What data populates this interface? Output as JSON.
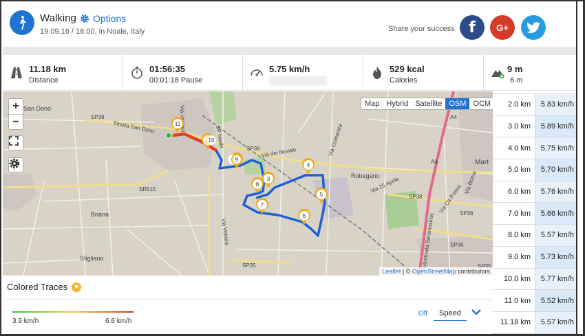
{
  "header": {
    "title": "Walking",
    "options_label": "Options",
    "subtitle": "19.09.16 / 16:00, in Noale, Italy",
    "share_text": "Share your success",
    "facebook_glyph": "f",
    "google_glyph": "G+"
  },
  "stats": [
    {
      "value": "11.18 km",
      "label": "Distance",
      "icon": "road-icon"
    },
    {
      "value": "01:56:35",
      "label": "00:01:18 Pause",
      "icon": "stopwatch-icon"
    },
    {
      "value": "5.75 km/h",
      "label": "",
      "icon": "speedometer-icon"
    },
    {
      "value": "529 kcal",
      "label": "Calories",
      "icon": "flame-icon"
    },
    {
      "value": "9 m",
      "label": "6 m",
      "icon": "elevation-icon"
    }
  ],
  "map": {
    "zoom_in": "+",
    "zoom_out": "−",
    "layers": [
      "Map",
      "Hybrid",
      "Satellite",
      "OSM",
      "OCM"
    ],
    "active_layer": "OSM",
    "attribution_leaflet": "Leaflet",
    "attribution_sep": " | © ",
    "attribution_osm": "OpenStreetMap",
    "attribution_tail": " contributors",
    "place_labels": [
      "San Dono",
      "Strada San Dono",
      "SP38",
      "SP38",
      "Via dei Novale",
      "Via Comarota",
      "Robegano",
      "SP38",
      "Mart",
      "SR515",
      "Briana",
      "Stigliano",
      "SP35",
      "SP36",
      "SP36",
      "SP35",
      "A4",
      "A4",
      "Via Roma",
      "Via Ca Rossa",
      "Via 25 Aprile",
      "Autostrada Serenissima",
      "Via Vettora",
      "SP Noale",
      "Via Valdest"
    ],
    "pins": [
      "11",
      "10",
      "9",
      "8",
      "7",
      "6",
      "5",
      "4",
      "3"
    ]
  },
  "traces": {
    "title": "Colored Traces",
    "min_label": "3.9 km/h",
    "max_label": "6.6 km/h",
    "off_label": "Off",
    "metric": "Speed"
  },
  "splits": [
    {
      "km": "2.0 km",
      "speed": "5.83 km/h"
    },
    {
      "km": "3.0 km",
      "speed": "5.89 km/h"
    },
    {
      "km": "4.0 km",
      "speed": "5.75 km/h"
    },
    {
      "km": "5.0 km",
      "speed": "5.70 km/h"
    },
    {
      "km": "6.0 km",
      "speed": "5.76 km/h"
    },
    {
      "km": "7.0 km",
      "speed": "5.66 km/h"
    },
    {
      "km": "8.0 km",
      "speed": "5.57 km/h"
    },
    {
      "km": "9.0 km",
      "speed": "5.73 km/h"
    },
    {
      "km": "10.0 km",
      "speed": "5.77 km/h"
    },
    {
      "km": "11.0 km",
      "speed": "5.52 km/h"
    },
    {
      "km": "11.18 km",
      "speed": "5.57 km/h"
    }
  ],
  "colors": {
    "accent": "#1f74d2",
    "route": "#1e5fd6",
    "route_fast": "#e0402a",
    "facebook": "#2b4b8c",
    "google": "#d63a2a",
    "twitter": "#279de0",
    "pin": "#f2a81d"
  }
}
